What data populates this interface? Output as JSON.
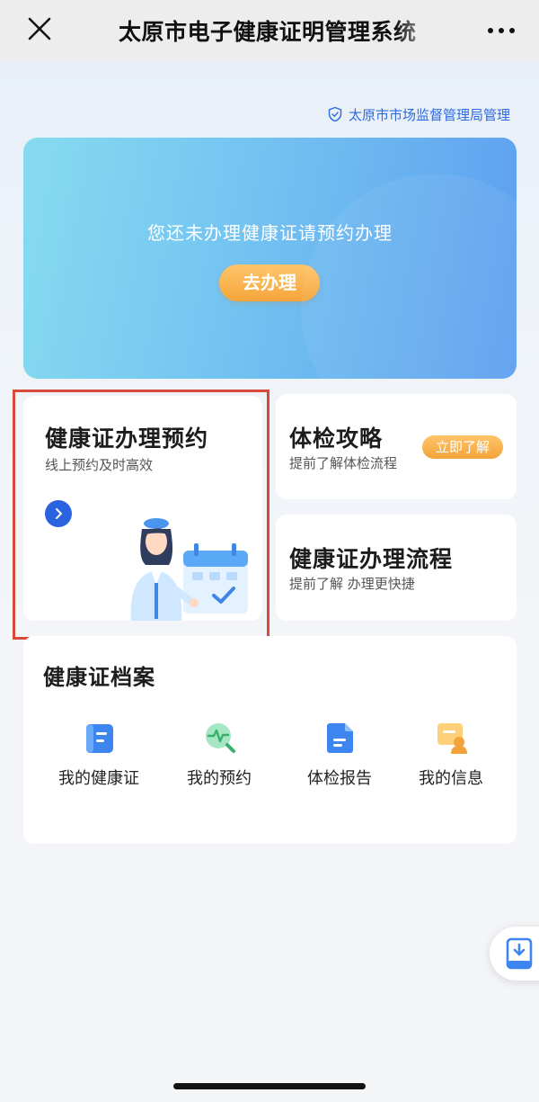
{
  "navbar": {
    "close_icon": "close-icon",
    "title": "太原市电子健康证明管理系统",
    "more_icon": "more-dots-icon"
  },
  "authority": {
    "icon": "shield-check-icon",
    "text": "太原市市场监督管理局管理"
  },
  "banner": {
    "message": "您还未办理健康证请预约办理",
    "button_label": "去办理"
  },
  "appointment_card": {
    "title": "健康证办理预约",
    "subtitle": "线上预约及时高效",
    "arrow_icon": "chevron-right-icon",
    "illustration": "nurse-calendar-illustration"
  },
  "guide_card": {
    "title": "体检攻略",
    "subtitle": "提前了解体检流程",
    "badge": "立即了解"
  },
  "flow_card": {
    "title": "健康证办理流程",
    "subtitle": "提前了解 办理更快捷"
  },
  "archive": {
    "title": "健康证档案",
    "items": [
      {
        "label": "我的健康证",
        "icon": "health-certificate-icon"
      },
      {
        "label": "我的预约",
        "icon": "appointment-search-icon"
      },
      {
        "label": "体检报告",
        "icon": "report-document-icon"
      },
      {
        "label": "我的信息",
        "icon": "user-info-icon"
      }
    ]
  },
  "float_button": {
    "icon": "download-tablet-icon"
  },
  "colors": {
    "accent_blue": "#2b62e0",
    "accent_orange": "#f5a53a",
    "highlight_red": "#d8493a"
  }
}
